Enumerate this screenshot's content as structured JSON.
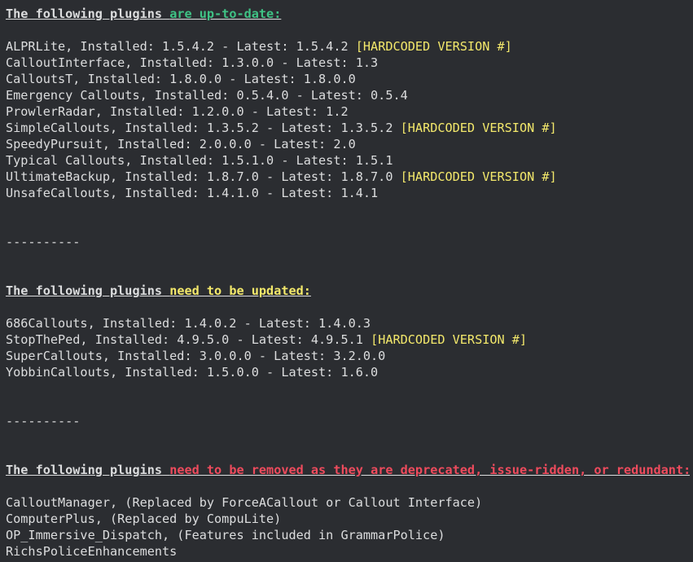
{
  "heading_lead": "The following plugins",
  "uptodate": {
    "status": "are up-to-date:",
    "items": [
      {
        "text": "ALPRLite, Installed: 1.5.4.2 - Latest: 1.5.4.2",
        "tag": "[HARDCODED VERSION #]"
      },
      {
        "text": "CalloutInterface, Installed: 1.3.0.0 - Latest: 1.3",
        "tag": ""
      },
      {
        "text": "CalloutsT, Installed: 1.8.0.0 - Latest: 1.8.0.0",
        "tag": ""
      },
      {
        "text": "Emergency Callouts, Installed: 0.5.4.0 - Latest: 0.5.4",
        "tag": ""
      },
      {
        "text": "ProwlerRadar, Installed: 1.2.0.0 - Latest: 1.2",
        "tag": ""
      },
      {
        "text": "SimpleCallouts, Installed: 1.3.5.2 - Latest: 1.3.5.2",
        "tag": "[HARDCODED VERSION #]"
      },
      {
        "text": "SpeedyPursuit, Installed: 2.0.0.0 - Latest: 2.0",
        "tag": ""
      },
      {
        "text": "Typical Callouts, Installed: 1.5.1.0 - Latest: 1.5.1",
        "tag": ""
      },
      {
        "text": "UltimateBackup, Installed: 1.8.7.0 - Latest: 1.8.7.0",
        "tag": "[HARDCODED VERSION #]"
      },
      {
        "text": "UnsafeCallouts, Installed: 1.4.1.0 - Latest: 1.4.1",
        "tag": ""
      }
    ]
  },
  "separator": "----------",
  "update": {
    "status": "need to be updated:",
    "items": [
      {
        "text": "686Callouts, Installed: 1.4.0.2 - Latest: 1.4.0.3",
        "tag": ""
      },
      {
        "text": "StopThePed, Installed: 4.9.5.0 - Latest: 4.9.5.1",
        "tag": "[HARDCODED VERSION #]"
      },
      {
        "text": "SuperCallouts, Installed: 3.0.0.0 - Latest: 3.2.0.0",
        "tag": ""
      },
      {
        "text": "YobbinCallouts, Installed: 1.5.0.0 - Latest: 1.6.0",
        "tag": ""
      }
    ]
  },
  "remove": {
    "status": "need to be removed as they are deprecated, issue-ridden, or redundant:",
    "items": [
      {
        "text": "CalloutManager, (Replaced by ForceACallout or Callout Interface)",
        "tag": ""
      },
      {
        "text": "ComputerPlus, (Replaced by CompuLite)",
        "tag": ""
      },
      {
        "text": "OP_Immersive_Dispatch, (Features included in GrammarPolice)",
        "tag": ""
      },
      {
        "text": "RichsPoliceEnhancements",
        "tag": ""
      }
    ]
  },
  "colors": {
    "background": "#2b2d31",
    "text": "#dcddde",
    "green": "#3fc285",
    "yellow": "#f3e86b",
    "red": "#ee4b5d"
  }
}
